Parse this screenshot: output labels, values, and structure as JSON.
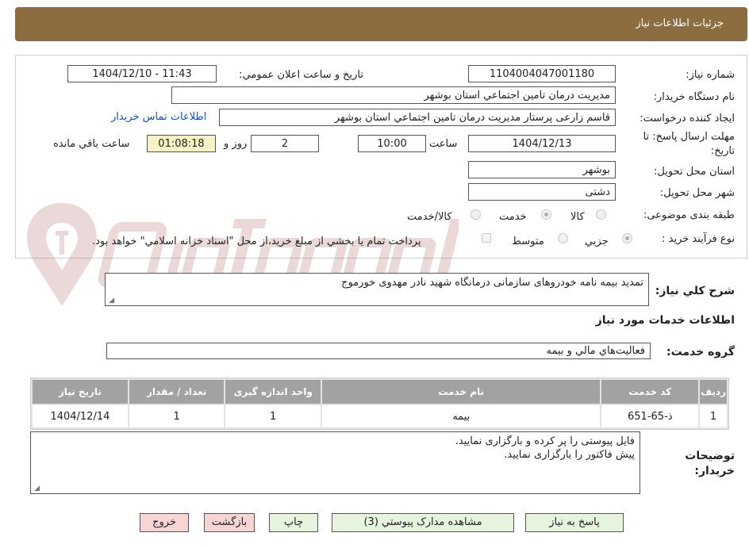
{
  "header": {
    "title": "جزئيات اطلاعات نياز"
  },
  "form": {
    "need_number_label": "شماره نياز:",
    "need_number": "1104004047001180",
    "announce_label": "تاريخ و ساعت اعلان عمومي:",
    "announce_value": "1404/12/10 - 11:43",
    "buyer_org_label": "نام دستگاه خريدار:",
    "buyer_org": "مديريت درمان تامين اجتماعي استان بوشهر",
    "creator_label": "ايجاد کننده درخواست:",
    "creator": "قاسم زارعی پرستار مديريت درمان تامين اجتماعي استان بوشهر",
    "contact_link": "اطلاعات تماس خريدار",
    "deadline_label_1": "مهلت ارسال پاسخ: تا",
    "deadline_label_2": "تاريخ:",
    "deadline_date": "1404/12/13",
    "time_label": "ساعت",
    "deadline_time": "10:00",
    "days_value": "2",
    "days_label": "روز و",
    "remaining_time": "01:08:18",
    "remaining_label": "ساعت باقي مانده",
    "province_label": "استان محل تحويل:",
    "province": "بوشهر",
    "city_label": "شهر محل تحويل:",
    "city": "دشتی",
    "category_label": "طبقه بندی موضوعی:",
    "category_options": [
      "کالا",
      "خدمت",
      "کالا/خدمت"
    ],
    "category_selected": "خدمت",
    "process_label": "نوع فرآيند خريد :",
    "process_options": [
      "جزيي",
      "متوسط"
    ],
    "process_selected": "جزيي",
    "payment_note": "پرداخت تمام يا بخشي از مبلغ خريد،از محل \"اسناد خزانه اسلامي\" خواهد بود."
  },
  "description": {
    "label": "شرح کلي نياز:",
    "text": "تمدید بیمه نامه خودروهای سازمانی درمانگاه شهید نادر مهدوی خورموج"
  },
  "services": {
    "title": "اطلاعات خدمات مورد نياز",
    "group_label": "گروه خدمت:",
    "group_value": "فعاليت‌هاي مالي و بيمه",
    "columns": [
      "رديف",
      "کد خدمت",
      "نام خدمت",
      "واحد اندازه گيری",
      "تعداد / مقدار",
      "تاريخ نياز"
    ],
    "rows": [
      [
        "1",
        "ذ-65-651",
        "بيمه",
        "1",
        "1",
        "1404/12/14"
      ]
    ]
  },
  "buyer_notes": {
    "label_1": "توضيحات",
    "label_2": "خريدار:",
    "line_1": "فایل پیوستی را پر کرده و بارگزاری نمایید.",
    "line_2": "پیش فاکتور را بارگزاری نمایید."
  },
  "buttons": {
    "reply": "پاسخ به نياز",
    "attachments": "مشاهده مدارک پيوستي (3)",
    "print": "چاپ",
    "back": "بازگشت",
    "exit": "خروج"
  },
  "colors": {
    "header_bg": "#8b6d3f",
    "table_header_bg": "#a2a2a2",
    "button_green": "#e6f4de",
    "button_red": "#f8d5d5",
    "remaining_bg": "#f6f2c4",
    "link": "#1a4fb5"
  }
}
